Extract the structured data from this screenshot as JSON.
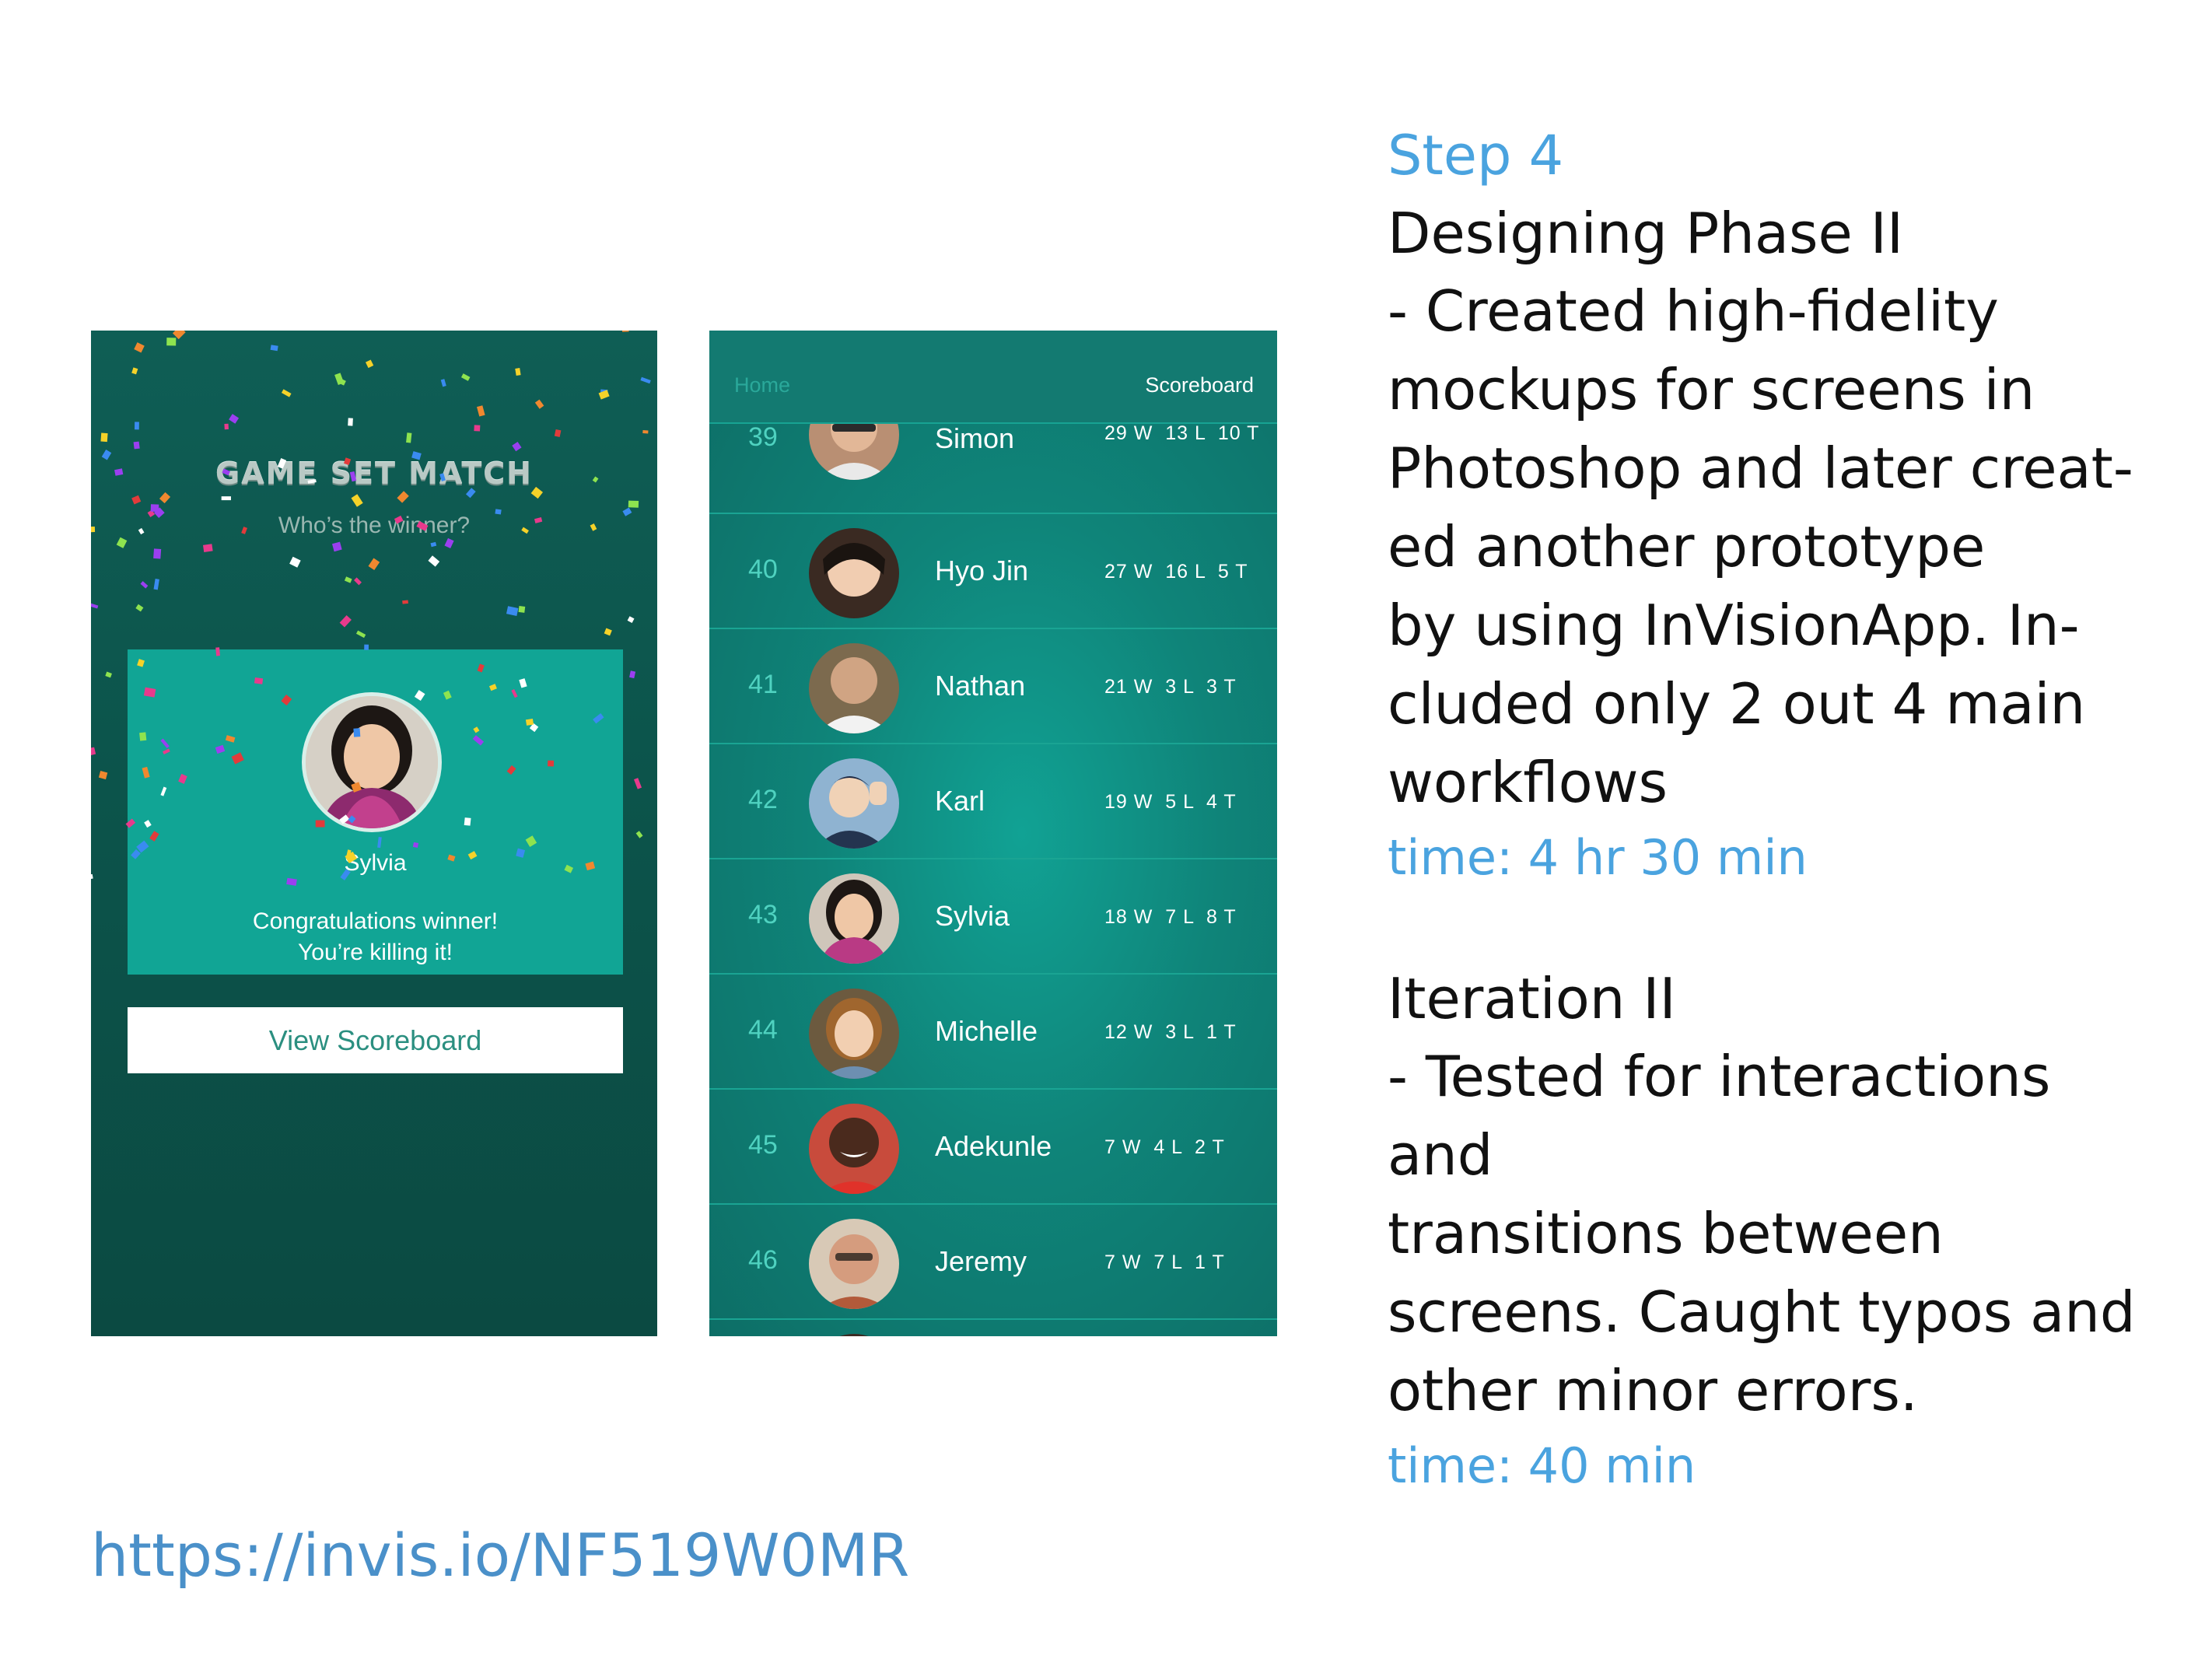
{
  "winner_screen": {
    "logo": "GAME SET MATCH",
    "subtitle": "Who’s the winner?",
    "winner_name": "Sylvia",
    "congrats_line1": "Congratulations winner!",
    "congrats_line2": "You’re killing it!",
    "button_label": "View Scoreboard"
  },
  "scoreboard_screen": {
    "nav_home": "Home",
    "nav_title": "Scoreboard",
    "rows": [
      {
        "rank": "39",
        "name": "Simon",
        "record": "29 W  13 L  10 T",
        "avatar_color": "#c99a7a"
      },
      {
        "rank": "40",
        "name": "Hyo Jin",
        "record": "27 W  16 L  5 T",
        "avatar_color": "#e5c4a8"
      },
      {
        "rank": "41",
        "name": "Nathan",
        "record": "21 W  3 L  3 T",
        "avatar_color": "#a98d76"
      },
      {
        "rank": "42",
        "name": "Karl",
        "record": "19 W  5 L  4 T",
        "avatar_color": "#3f5877"
      },
      {
        "rank": "43",
        "name": "Sylvia",
        "record": "18 W  7 L  8 T",
        "avatar_color": "#d8b497"
      },
      {
        "rank": "44",
        "name": "Michelle",
        "record": "12 W  3 L  1 T",
        "avatar_color": "#c89f78"
      },
      {
        "rank": "45",
        "name": "Adekunle",
        "record": "7 W  4 L  2 T",
        "avatar_color": "#5a3324"
      },
      {
        "rank": "46",
        "name": "Jeremy",
        "record": "7 W  7 L  1 T",
        "avatar_color": "#c49177"
      }
    ]
  },
  "notes": {
    "step": "Step 4",
    "heading1": "Designing Phase II",
    "body1": "- Created high-fidelity\nmockups for screens in\nPhotoshop and later creat-\ned another prototype\nby using InVisionApp. In-\ncluded only 2 out 4 main\nworkflows",
    "time1": "time: 4 hr 30 min",
    "heading2": "Iteration II",
    "body2": "- Tested for interactions and\ntransitions between\nscreens. Caught typos and\nother minor errors.",
    "time2": "time: 40 min"
  },
  "link": "https://invis.io/NF519W0MR",
  "colors": {
    "accent_blue": "#4aa3df",
    "teal": "#11a595",
    "dark_teal": "#0f5e55"
  }
}
